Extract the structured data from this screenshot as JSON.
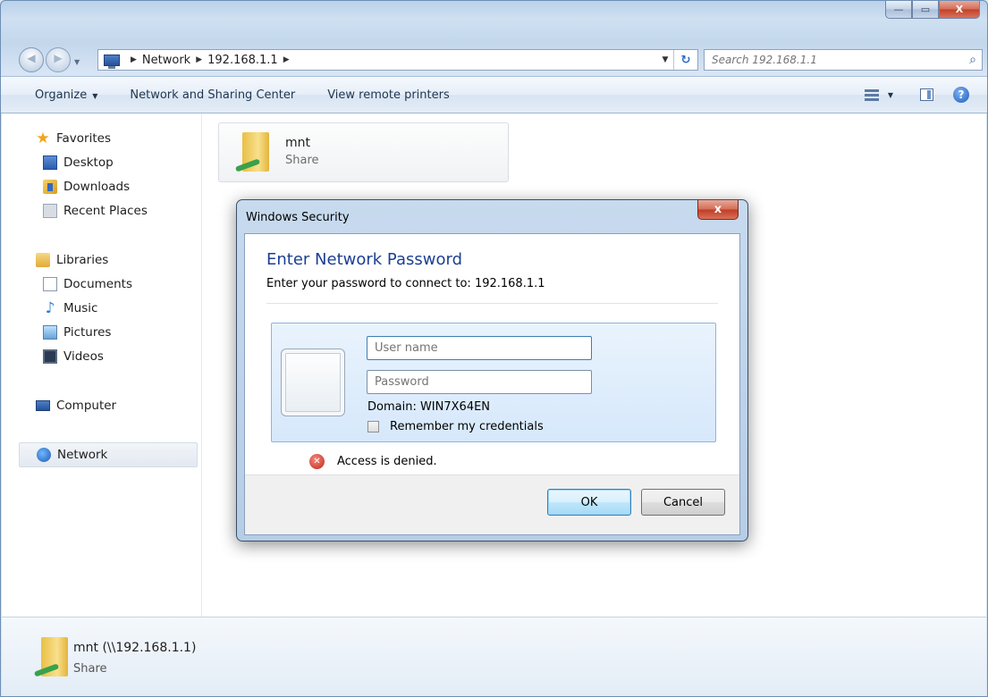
{
  "window": {
    "caption_buttons": {
      "minimize": "—",
      "maximize": "▭",
      "close": "X"
    }
  },
  "navbar": {
    "back_glyph": "◀",
    "forward_glyph": "▶",
    "breadcrumb": [
      "Network",
      "192.168.1.1"
    ],
    "search_placeholder": "Search 192.168.1.1"
  },
  "commandbar": {
    "organize": "Organize",
    "network_sharing": "Network and Sharing Center",
    "remote_printers": "View remote printers"
  },
  "sidebar": {
    "favorites": "Favorites",
    "desktop": "Desktop",
    "downloads": "Downloads",
    "recent_places": "Recent Places",
    "libraries": "Libraries",
    "documents": "Documents",
    "music": "Music",
    "pictures": "Pictures",
    "videos": "Videos",
    "computer": "Computer",
    "network": "Network"
  },
  "folder": {
    "name": "mnt",
    "type": "Share"
  },
  "details": {
    "name": "mnt (\\\\192.168.1.1)",
    "type": "Share"
  },
  "dialog": {
    "title": "Windows Security",
    "close_glyph": "x",
    "heading": "Enter Network Password",
    "subtitle": "Enter your password to connect to: 192.168.1.1",
    "username_placeholder": "User name",
    "password_placeholder": "Password",
    "domain": "Domain: WIN7X64EN",
    "remember": "Remember my credentials",
    "error": "Access is denied.",
    "ok": "OK",
    "cancel": "Cancel"
  },
  "icons": {
    "search": "search-icon",
    "refresh": "refresh-icon",
    "help": "help-icon",
    "error": "error-icon",
    "folder": "shared-folder-icon"
  },
  "colors": {
    "heading": "#1c3f94",
    "selection": "#e3e9f1",
    "close": "#c1402a"
  }
}
